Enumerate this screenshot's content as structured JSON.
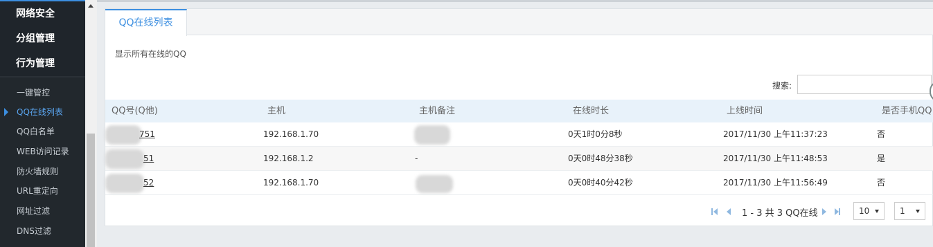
{
  "sidebar": {
    "categories": [
      "网络安全",
      "分组管理",
      "行为管理"
    ],
    "items": [
      {
        "label": "一键管控"
      },
      {
        "label": "QQ在线列表",
        "active": true
      },
      {
        "label": "QQ白名单"
      },
      {
        "label": "WEB访问记录"
      },
      {
        "label": "防火墙规则"
      },
      {
        "label": "URL重定向"
      },
      {
        "label": "网址过滤"
      },
      {
        "label": "DNS过滤"
      }
    ]
  },
  "tab": {
    "label": "QQ在线列表"
  },
  "description": "显示所有在线的QQ",
  "search": {
    "label": "搜索:",
    "value": "",
    "placeholder": ""
  },
  "table": {
    "columns": [
      "QQ号(Q他)",
      "主机",
      "主机备注",
      "在线时长",
      "上线时间",
      "是否手机QQ"
    ],
    "rows": [
      {
        "qq": "751",
        "host": "192.168.1.70",
        "note": "",
        "duration": "0天1时0分8秒",
        "login_time": "2017/11/30 上午11:37:23",
        "mobile": "否"
      },
      {
        "qq": "51",
        "host": "192.168.1.2",
        "note": "-",
        "duration": "0天0时48分38秒",
        "login_time": "2017/11/30 上午11:48:53",
        "mobile": "是"
      },
      {
        "qq": "52",
        "host": "192.168.1.70",
        "note": "",
        "duration": "0天0时40分42秒",
        "login_time": "2017/11/30 上午11:56:49",
        "mobile": "否"
      }
    ]
  },
  "pager": {
    "text": "1 - 3 共 3 QQ在线",
    "page_size": "10",
    "page": "1"
  },
  "colors": {
    "accent": "#3b8ee0",
    "sidebar_bg": "#2b3137",
    "header_bg": "#e8f2fa"
  }
}
